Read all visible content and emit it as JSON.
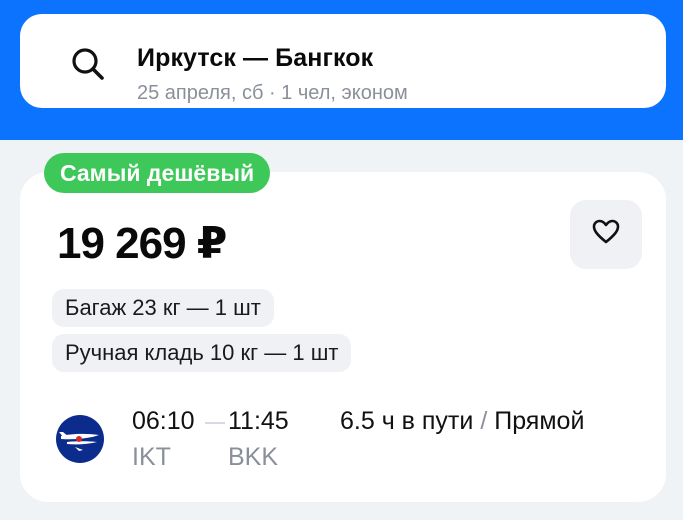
{
  "search": {
    "route": "Иркутск — Бангкок",
    "details": "25 апреля, сб · 1 чел, эконом"
  },
  "ticket": {
    "badge": "Самый дешёвый",
    "price": "19 269 ₽",
    "baggage": "Багаж 23 кг — 1 шт",
    "hand_luggage": "Ручная кладь 10 кг — 1 шт",
    "departure_time": "06:10",
    "arrival_time": "11:45",
    "departure_code": "IKT",
    "arrival_code": "BKK",
    "duration": "6.5 ч в пути",
    "separator": "/",
    "stops": "Прямой"
  },
  "icons": {
    "search": "search-icon",
    "favorite": "heart-icon",
    "airline": "airline-logo"
  },
  "colors": {
    "header_blue": "#0c73fe",
    "badge_green": "#3ec85a",
    "airline_blue": "#0b2c8c"
  }
}
